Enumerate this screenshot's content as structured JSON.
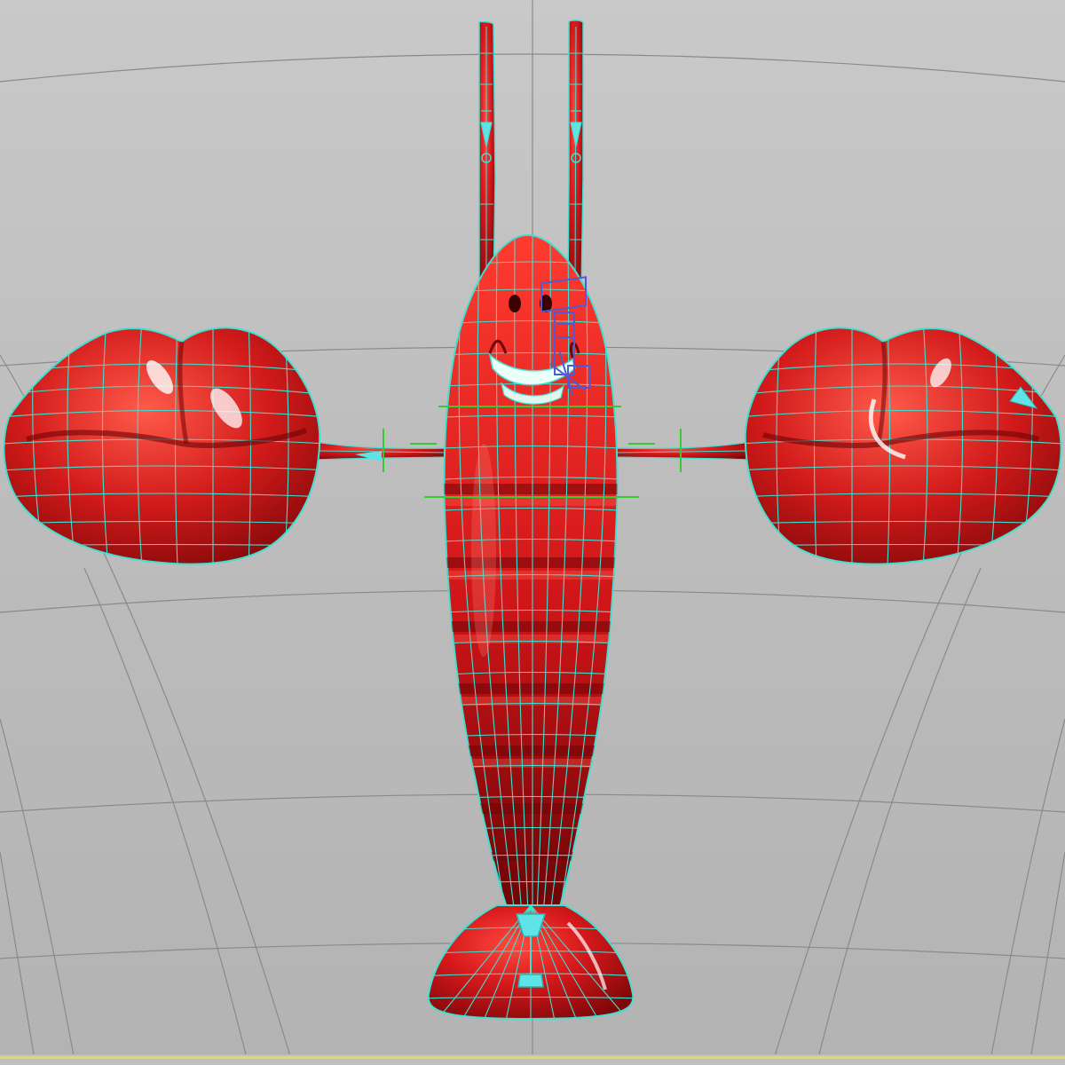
{
  "viewport": {
    "background": "#bdbdbd",
    "grid_color": "#8a8a8a",
    "wire_color": "#40e0d0",
    "model_color": "#d7191c",
    "model_shadow": "#8f0a0c",
    "highlight_color": "#ffffff",
    "gizmo_color": "#4f5bd5",
    "manipulator_color": "#33cc33",
    "selection_edge_color": "#d8d68a"
  },
  "model": {
    "subject": "cartoon lobster",
    "parts": [
      "antenna-left",
      "antenna-right",
      "head",
      "face",
      "body-segments",
      "arm-left",
      "arm-right",
      "claw-left",
      "claw-right",
      "tail-fan"
    ],
    "body_segments": 9
  }
}
